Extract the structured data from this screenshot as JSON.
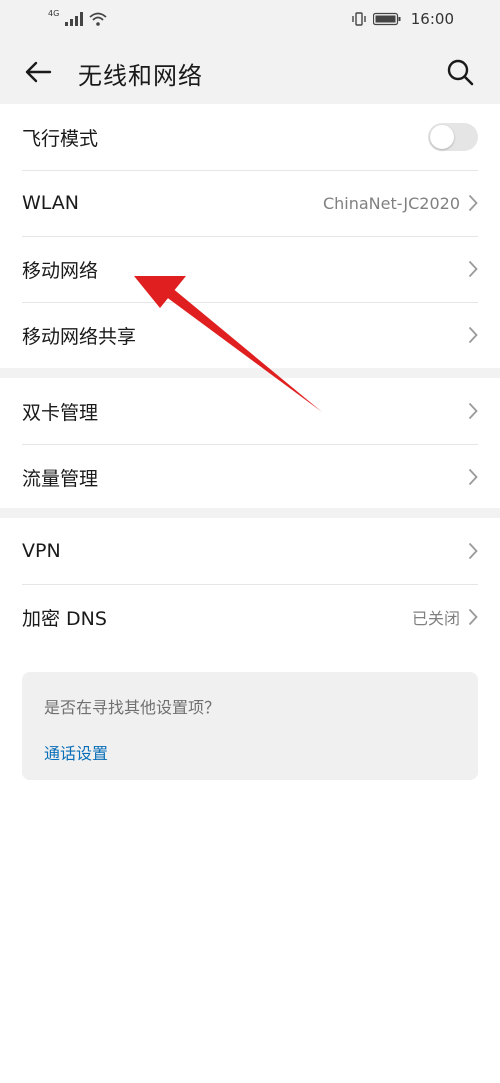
{
  "status_bar": {
    "network_label": "4G",
    "time": "16:00"
  },
  "header": {
    "title": "无线和网络"
  },
  "group1": [
    {
      "label": "飞行模式",
      "value": "",
      "toggle": false
    },
    {
      "label": "WLAN",
      "value": "ChinaNet-JC2020"
    },
    {
      "label": "移动网络",
      "value": ""
    },
    {
      "label": "移动网络共享",
      "value": ""
    }
  ],
  "group2": [
    {
      "label": "双卡管理"
    },
    {
      "label": "流量管理"
    }
  ],
  "group3": [
    {
      "label": "VPN",
      "value": ""
    },
    {
      "label": "加密 DNS",
      "value": "已关闭"
    }
  ],
  "suggest": {
    "question": "是否在寻找其他设置项？",
    "link": "通话设置"
  },
  "colors": {
    "accent_link": "#0a6fb8",
    "annotation_arrow": "#e02020",
    "band_bg": "#f2f2f2"
  }
}
